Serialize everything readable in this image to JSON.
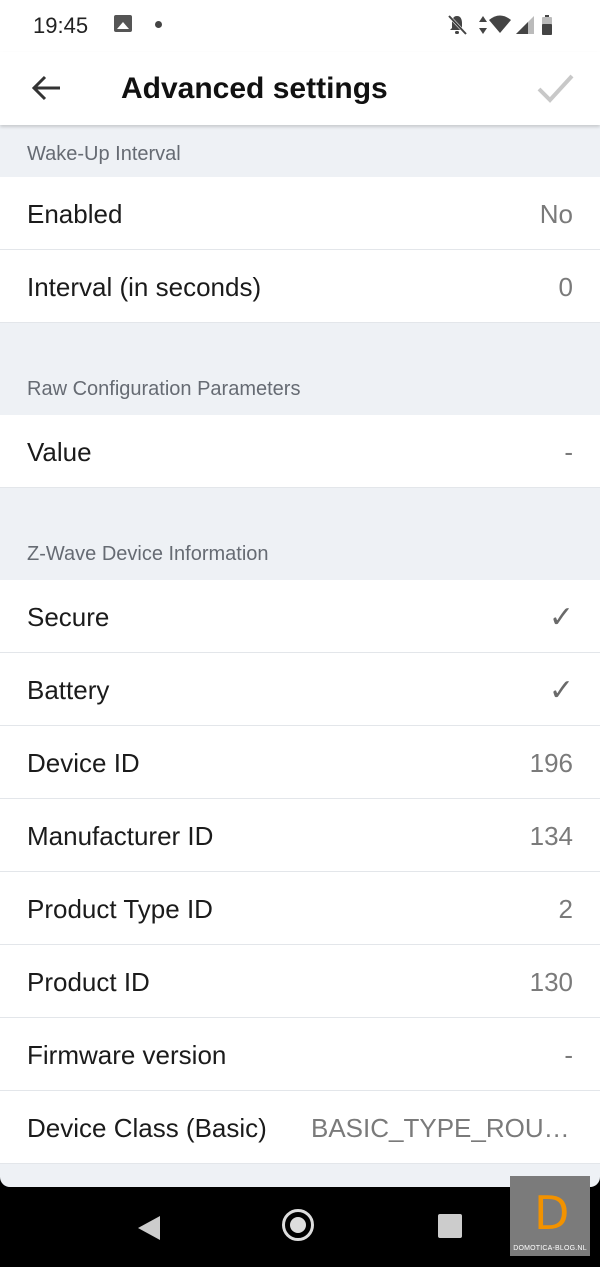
{
  "status_bar": {
    "time": "19:45",
    "icons": [
      "gallery-icon",
      "dot-icon",
      "notifications-off-icon",
      "data-arrows-icon",
      "wifi-icon",
      "signal-icon",
      "battery-icon"
    ]
  },
  "app_bar": {
    "title": "Advanced settings",
    "back_icon": "arrow-back-icon",
    "done_icon": "check-icon"
  },
  "sections": [
    {
      "header": "Wake-Up Interval",
      "rows": [
        {
          "label": "Enabled",
          "value": "No"
        },
        {
          "label": "Interval (in seconds)",
          "value": "0"
        }
      ]
    },
    {
      "header": "Raw Configuration Parameters",
      "rows": [
        {
          "label": "Value",
          "value": "-"
        }
      ]
    },
    {
      "header": "Z-Wave Device Information",
      "rows": [
        {
          "label": "Secure",
          "value": "✓"
        },
        {
          "label": "Battery",
          "value": "✓"
        },
        {
          "label": "Device ID",
          "value": "196"
        },
        {
          "label": "Manufacturer ID",
          "value": "134"
        },
        {
          "label": "Product Type ID",
          "value": "2"
        },
        {
          "label": "Product ID",
          "value": "130"
        },
        {
          "label": "Firmware version",
          "value": "-"
        },
        {
          "label": "Device Class (Basic)",
          "value": "BASIC_TYPE_ROUT…"
        }
      ]
    }
  ],
  "watermark": {
    "letter": "D",
    "text": "DOMOTICA-BLOG.NL",
    "accent": "#f29200"
  },
  "colors": {
    "background": "#eef1f5",
    "section_text": "#666b73",
    "value_text": "#7a7a7a"
  }
}
